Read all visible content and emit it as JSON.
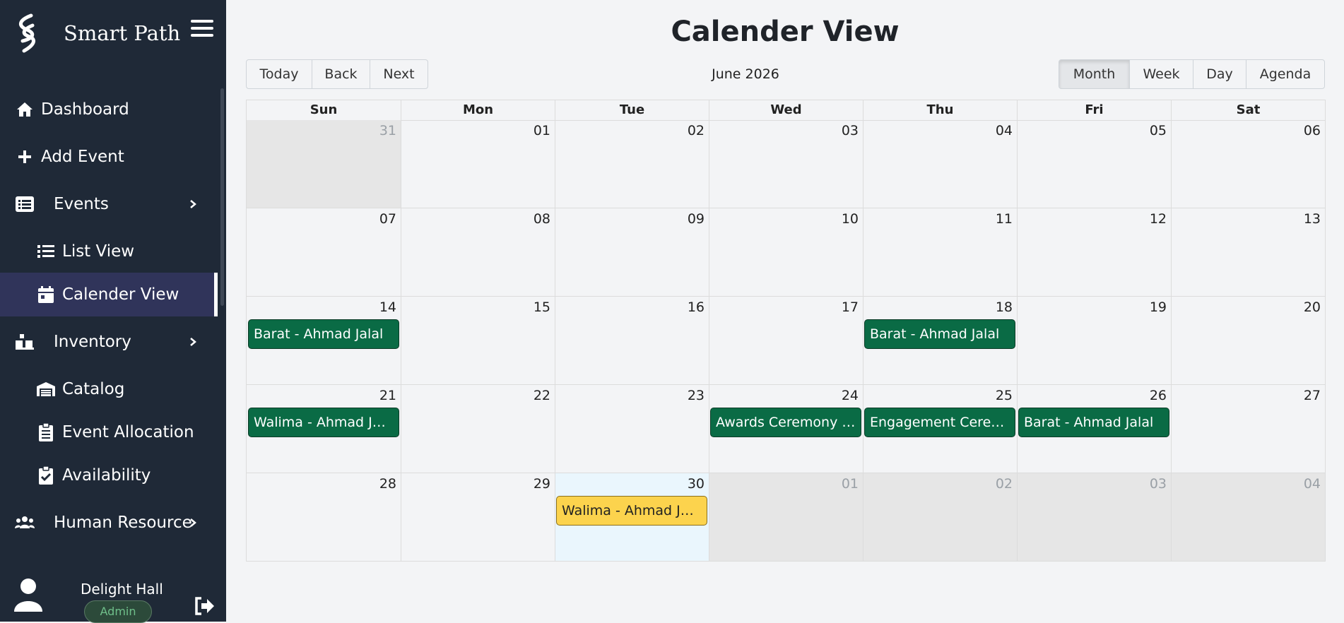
{
  "app": {
    "name": "Smart Path"
  },
  "sidebar": {
    "items": [
      {
        "label": "Dashboard",
        "icon": "home-icon"
      },
      {
        "label": "Add Event",
        "icon": "plus-icon"
      },
      {
        "label": "Events",
        "icon": "list-alt-icon",
        "has_children": true
      },
      {
        "label": "List View",
        "icon": "list-icon",
        "sub": true
      },
      {
        "label": "Calender View",
        "icon": "calendar-icon",
        "sub": true,
        "active": true
      },
      {
        "label": "Inventory",
        "icon": "boxes-icon",
        "has_children": true
      },
      {
        "label": "Catalog",
        "icon": "warehouse-icon",
        "sub": true
      },
      {
        "label": "Event Allocation",
        "icon": "clipboard-list-icon",
        "sub": true
      },
      {
        "label": "Availability",
        "icon": "clipboard-check-icon",
        "sub": true
      },
      {
        "label": "Human Resource",
        "icon": "users-icon",
        "has_children": true
      }
    ],
    "user": {
      "name": "Delight Hall",
      "role": "Admin"
    }
  },
  "page": {
    "title": "Calender View"
  },
  "toolbar": {
    "today": "Today",
    "back": "Back",
    "next": "Next",
    "month_label": "June 2026",
    "views": {
      "month": "Month",
      "week": "Week",
      "day": "Day",
      "agenda": "Agenda"
    },
    "active_view": "Month"
  },
  "calendar": {
    "weekdays": [
      "Sun",
      "Mon",
      "Tue",
      "Wed",
      "Thu",
      "Fri",
      "Sat"
    ],
    "weeks": [
      [
        "31",
        "01",
        "02",
        "03",
        "04",
        "05",
        "06"
      ],
      [
        "07",
        "08",
        "09",
        "10",
        "11",
        "12",
        "13"
      ],
      [
        "14",
        "15",
        "16",
        "17",
        "18",
        "19",
        "20"
      ],
      [
        "21",
        "22",
        "23",
        "24",
        "25",
        "26",
        "27"
      ],
      [
        "28",
        "29",
        "30",
        "01",
        "02",
        "03",
        "04"
      ]
    ],
    "events": {
      "e1": "Barat - Ahmad Jalal",
      "e2": "Barat - Ahmad Jalal",
      "e3": "Walima - Ahmad Jalal",
      "e4": "Awards Ceremony - ...",
      "e5": "Engagement Cerem...",
      "e6": "Barat - Ahmad Jalal",
      "e7": "Walima - Ahmad Jalal"
    },
    "colors": {
      "event_green": "#0a6b45",
      "event_yellow": "#fcd34d",
      "sidebar_bg": "#1f2937"
    }
  }
}
